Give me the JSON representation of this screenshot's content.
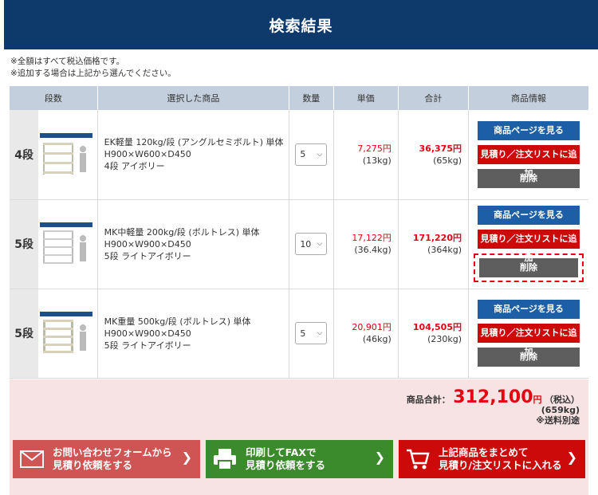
{
  "header": {
    "title": "検索結果"
  },
  "notes": [
    "※全額はすべて税込価格です。",
    "※追加する場合は上記から選んでください。"
  ],
  "table": {
    "columns": [
      "段数",
      "選択した商品",
      "数量",
      "単価",
      "合計",
      "商品情報"
    ],
    "rows": [
      {
        "dan": "4段",
        "name": "EK軽量 120kg/段 (アングルセミボルト) 単体",
        "size": "H900×W600×D450",
        "spec": "4段 アイボリー",
        "qty": "5",
        "unit_price": "7,275円",
        "unit_weight": "(13kg)",
        "total_price": "36,375円",
        "total_weight": "(65kg)"
      },
      {
        "dan": "5段",
        "name": "MK中軽量 200kg/段 (ボルトレス) 単体",
        "size": "H900×W900×D450",
        "spec": "5段 ライトアイボリー",
        "qty": "10",
        "unit_price": "17,122円",
        "unit_weight": "(36.4kg)",
        "total_price": "171,220円",
        "total_weight": "(364kg)"
      },
      {
        "dan": "5段",
        "name": "MK重量 500kg/段 (ボルトレス) 単体",
        "size": "H900×W900×D450",
        "spec": "5段 ライトアイボリー",
        "qty": "5",
        "unit_price": "20,901円",
        "unit_weight": "(46kg)",
        "total_price": "104,505円",
        "total_weight": "(230kg)"
      }
    ],
    "buttons": {
      "product_page": "商品ページを見る",
      "add_to_list": "見積り／注文リストに追加",
      "delete": "削除"
    }
  },
  "summary": {
    "label": "商品合計：",
    "price": "312,100",
    "yen": "円",
    "tax": "（税込）",
    "weight": "(659kg)",
    "shipping_note": "※送料別途"
  },
  "actions": [
    {
      "line1": "お問い合わせフォームから",
      "line2": "見積り依頼をする",
      "icon": "mail-icon"
    },
    {
      "line1": "印刷してFAXで",
      "line2": "見積り依頼をする",
      "icon": "printer-icon"
    },
    {
      "line1": "上記商品をまとめて",
      "line2": "見積り/注文リストに入れる",
      "icon": "cart-icon"
    }
  ],
  "colors": {
    "header_bg": "#0e3a6b",
    "blue_button": "#1d5fa6",
    "red_button": "#cc0a0a",
    "gray_button": "#5e5e5e",
    "price_red": "#e60012",
    "summary_bg": "#f8e3e4",
    "mail_button": "#cf5454",
    "fax_button": "#3b8a2c",
    "cart_button": "#cc0a0a"
  }
}
